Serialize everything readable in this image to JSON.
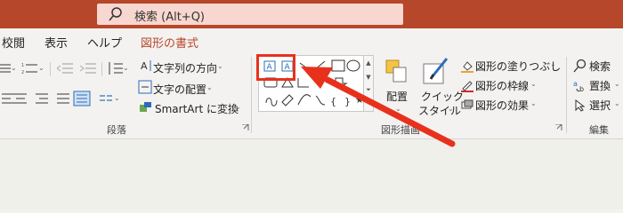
{
  "search": {
    "icon": "search-icon",
    "label": "検索 (Alt+Q)"
  },
  "tabs": [
    "校閲",
    "表示",
    "ヘルプ",
    "図形の書式"
  ],
  "paragraph": {
    "text_direction": "文字列の方向",
    "text_align": "文字の配置",
    "smartart": "SmartArt に変換",
    "group_label": "段落"
  },
  "drawing": {
    "arrange": "配置",
    "quick_style_line1": "クイック",
    "quick_style_line2": "スタイル",
    "fill": "図形の塗りつぶし",
    "outline": "図形の枠線",
    "effects": "図形の効果",
    "group_label": "図形描画"
  },
  "editing": {
    "find": "検索",
    "replace": "置換",
    "select": "選択",
    "group_label": "編集"
  },
  "colors": {
    "titlebar": "#b7472a",
    "accent": "#b7472a",
    "highlight": "#e8311c"
  }
}
